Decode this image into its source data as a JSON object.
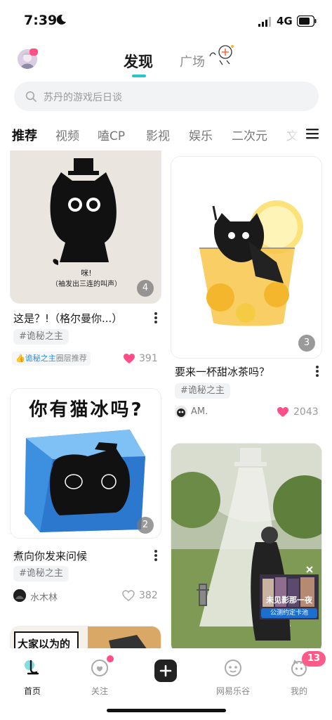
{
  "status_bar": {
    "time": "7:39",
    "network": "4G"
  },
  "header": {
    "tab_active": "发现",
    "tab_other": "广场"
  },
  "search": {
    "placeholder": "苏丹的游戏后日谈"
  },
  "categories": [
    "推荐",
    "视频",
    "嗑CP",
    "影视",
    "娱乐",
    "二次元",
    "文"
  ],
  "posts": [
    {
      "title": "这是？!（格尔曼你...）",
      "image_count": "4",
      "image_caption_line1": "咪!",
      "image_caption_line2": "（袖发出三连的叫声）",
      "tag": "#诡秘之主",
      "circle_name": "诡秘之主",
      "circle_suffix": "圈层推荐",
      "likes": "391",
      "liked": true
    },
    {
      "title": "要来一杯甜冰茶吗？",
      "image_count": "3",
      "tag": "#诡秘之主",
      "author": "AM.",
      "likes": "2043",
      "liked": true
    },
    {
      "title": "煮向你发来问候",
      "image_count": "2",
      "image_headline": "你有猫冰吗?",
      "tag": "#诡秘之主",
      "author": "水木林",
      "likes": "382",
      "liked": false
    },
    {
      "image_headline": "大家以为的"
    },
    {
      "ad_caption": "公测约定卡池",
      "ad_title": "未见影那一夜"
    }
  ],
  "bottom_nav": {
    "home": "首页",
    "follow": "关注",
    "music_valley": "网易乐谷",
    "mine": "我的",
    "mine_badge": "13"
  },
  "colors": {
    "accent": "#26c6c9",
    "heart": "#ff4f86",
    "badge": "#ff5a8a"
  }
}
